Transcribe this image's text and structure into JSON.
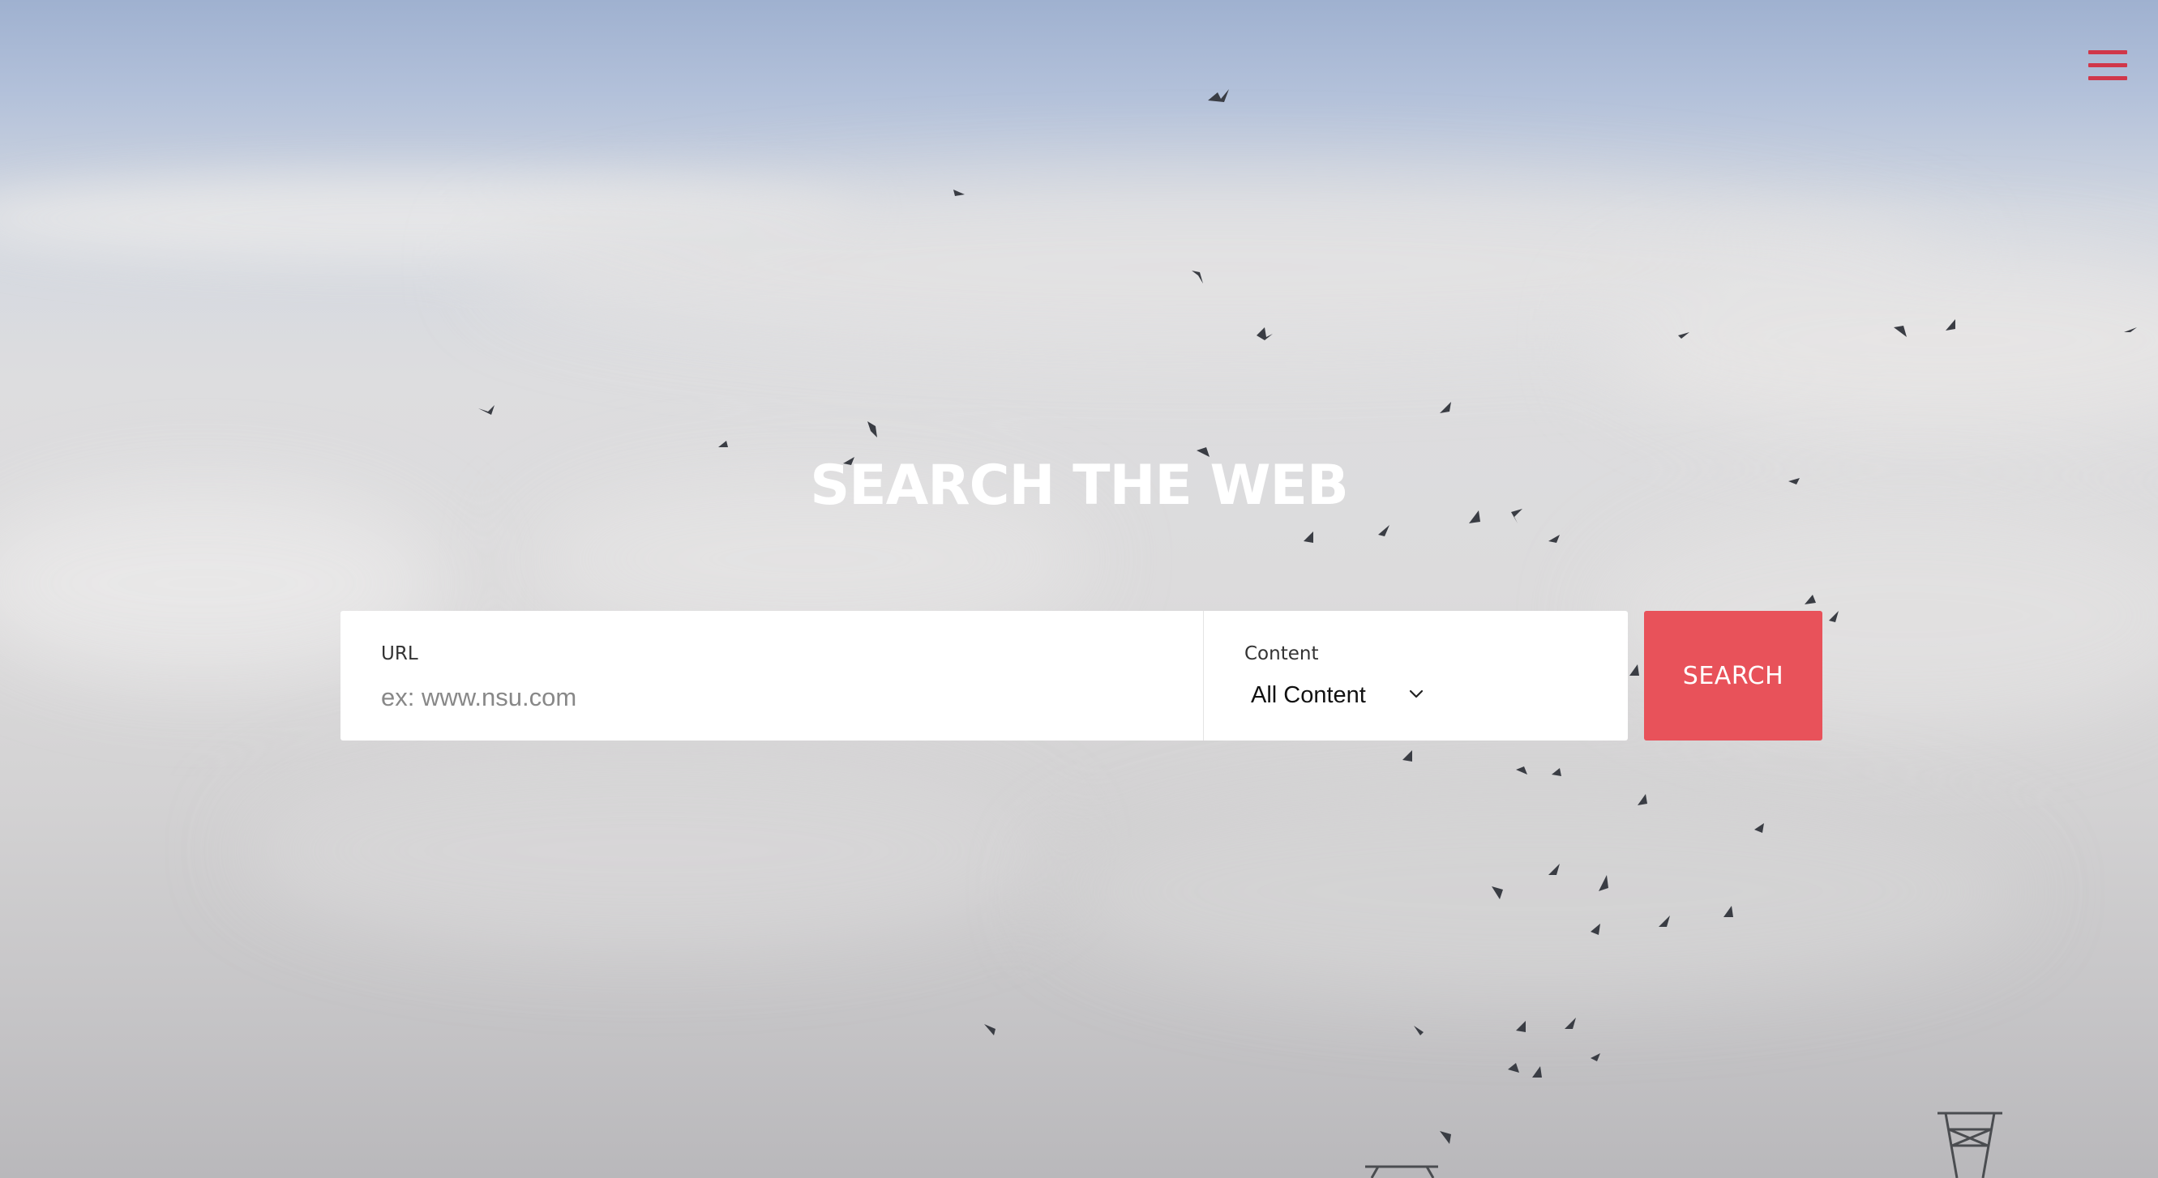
{
  "header": {
    "menu_icon": "hamburger-menu-icon",
    "accent_color": "#d0374a"
  },
  "hero": {
    "title": "SEARCH THE WEB"
  },
  "search_form": {
    "url_label": "URL",
    "url_placeholder": "ex: www.nsu.com",
    "url_value": "",
    "content_label": "Content",
    "content_selected": "All Content",
    "content_dropdown_icon": "chevron-down-icon",
    "search_button_label": "SEARCH",
    "button_color": "#e8525a"
  },
  "background": {
    "scene": "sky-with-birds-photo"
  }
}
